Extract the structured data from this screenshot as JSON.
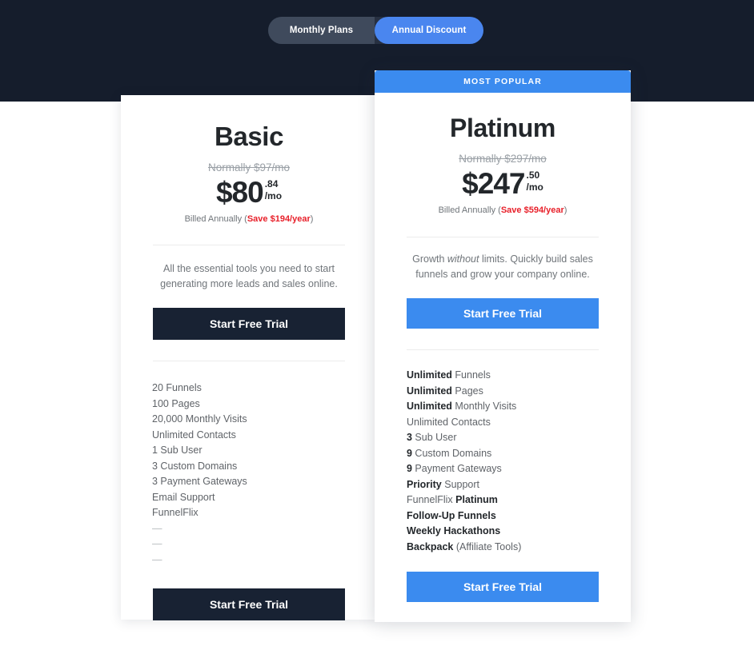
{
  "theme": {
    "header_bg": "#151d2c",
    "accent_blue": "#3b8bef",
    "toggle_active_blue": "#4a86ef",
    "dark_button": "#182233",
    "save_red": "#e8202a"
  },
  "billing_toggle": {
    "monthly_label": "Monthly Plans",
    "annual_label": "Annual Discount",
    "selected": "Annual Discount"
  },
  "plans": {
    "basic": {
      "name": "Basic",
      "normally": "Normally $97/mo",
      "price_main": "$80",
      "price_cents": ".84",
      "price_per": "/mo",
      "billed_prefix": "Billed Annually (",
      "billed_save": "Save $194/year",
      "billed_suffix": ")",
      "description": "All the essential tools you need to start generating more leads and sales online.",
      "cta_top": "Start Free Trial",
      "cta_bottom": "Start Free Trial",
      "features": [
        "20 Funnels",
        "100 Pages",
        "20,000 Monthly Visits",
        "Unlimited Contacts",
        "1 Sub User",
        "3 Custom Domains",
        "3 Payment Gateways",
        "Email Support",
        "FunnelFlix",
        "—",
        "—",
        "—"
      ]
    },
    "platinum": {
      "badge": "MOST POPULAR",
      "name": "Platinum",
      "normally": "Normally $297/mo",
      "price_main": "$247",
      "price_cents": ".50",
      "price_per": "/mo",
      "billed_prefix": "Billed Annually (",
      "billed_save": "Save $594/year",
      "billed_suffix": ")",
      "description_part1": "Growth ",
      "description_emphasis": "without",
      "description_part2": " limits. Quickly build sales funnels and grow your company online.",
      "cta_top": "Start Free Trial",
      "cta_bottom": "Start Free Trial",
      "features": [
        {
          "bold": "Unlimited",
          "rest": " Funnels"
        },
        {
          "bold": "Unlimited",
          "rest": " Pages"
        },
        {
          "bold": "Unlimited",
          "rest": " Monthly Visits"
        },
        {
          "bold": "",
          "rest": "Unlimited Contacts"
        },
        {
          "bold": "3",
          "rest": " Sub User"
        },
        {
          "bold": "9",
          "rest": " Custom Domains"
        },
        {
          "bold": "9",
          "rest": " Payment Gateways"
        },
        {
          "bold": "Priority",
          "rest": " Support"
        },
        {
          "pre": "FunnelFlix ",
          "bold": "Platinum",
          "rest": ""
        },
        {
          "bold": "Follow-Up Funnels",
          "rest": ""
        },
        {
          "bold": "Weekly Hackathons",
          "rest": ""
        },
        {
          "bold": "Backpack",
          "rest": " (Affiliate Tools)"
        }
      ]
    }
  }
}
